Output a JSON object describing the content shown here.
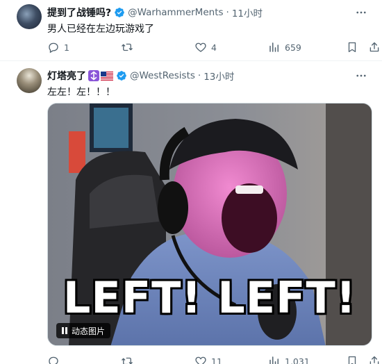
{
  "tweets": [
    {
      "name": "提到了战锤吗?",
      "handle": "@WarhammerMents",
      "time": "11小时",
      "text": "男人已经在左边玩游戏了",
      "stats": {
        "replies": "1",
        "retweets": "",
        "likes": "4",
        "views": "659"
      }
    },
    {
      "name": "灯塔亮了",
      "handle": "@WestResists",
      "time": "13小时",
      "text": "左左！左！！！",
      "media": {
        "caption": "LEFT! LEFT!",
        "gif_label": "动态图片"
      },
      "stats": {
        "replies": "",
        "retweets": "",
        "likes": "11",
        "views": "1,031"
      }
    }
  ],
  "colors": {
    "verified": "#1d9bf0",
    "secondary_text": "#536471",
    "primary_text": "#0f1419",
    "divider": "#eff3f4"
  },
  "icons": [
    "reply-icon",
    "retweet-icon",
    "like-icon",
    "views-icon",
    "bookmark-icon",
    "share-icon",
    "more-icon",
    "verified-icon",
    "pause-icon"
  ]
}
